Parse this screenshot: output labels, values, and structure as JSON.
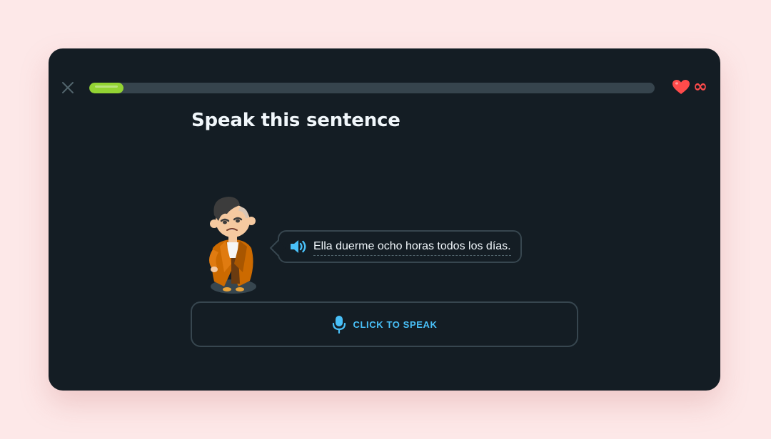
{
  "lesson": {
    "progress_percent": 6,
    "title": "Speak this sentence",
    "hearts": {
      "count_symbol": "∞",
      "color": "#ff4b4b"
    }
  },
  "prompt": {
    "sentence": "Ella duerme ocho horas todos los días.",
    "speaker_icon": "speaker-icon"
  },
  "speak_button": {
    "label": "CLICK TO SPEAK",
    "icon": "microphone-icon"
  },
  "colors": {
    "background": "#fde8e8",
    "window": "#141d24",
    "progress_fill": "#93d333",
    "progress_track": "#36444d",
    "accent_blue": "#49c0f8",
    "heart_red": "#ff4b4b"
  }
}
